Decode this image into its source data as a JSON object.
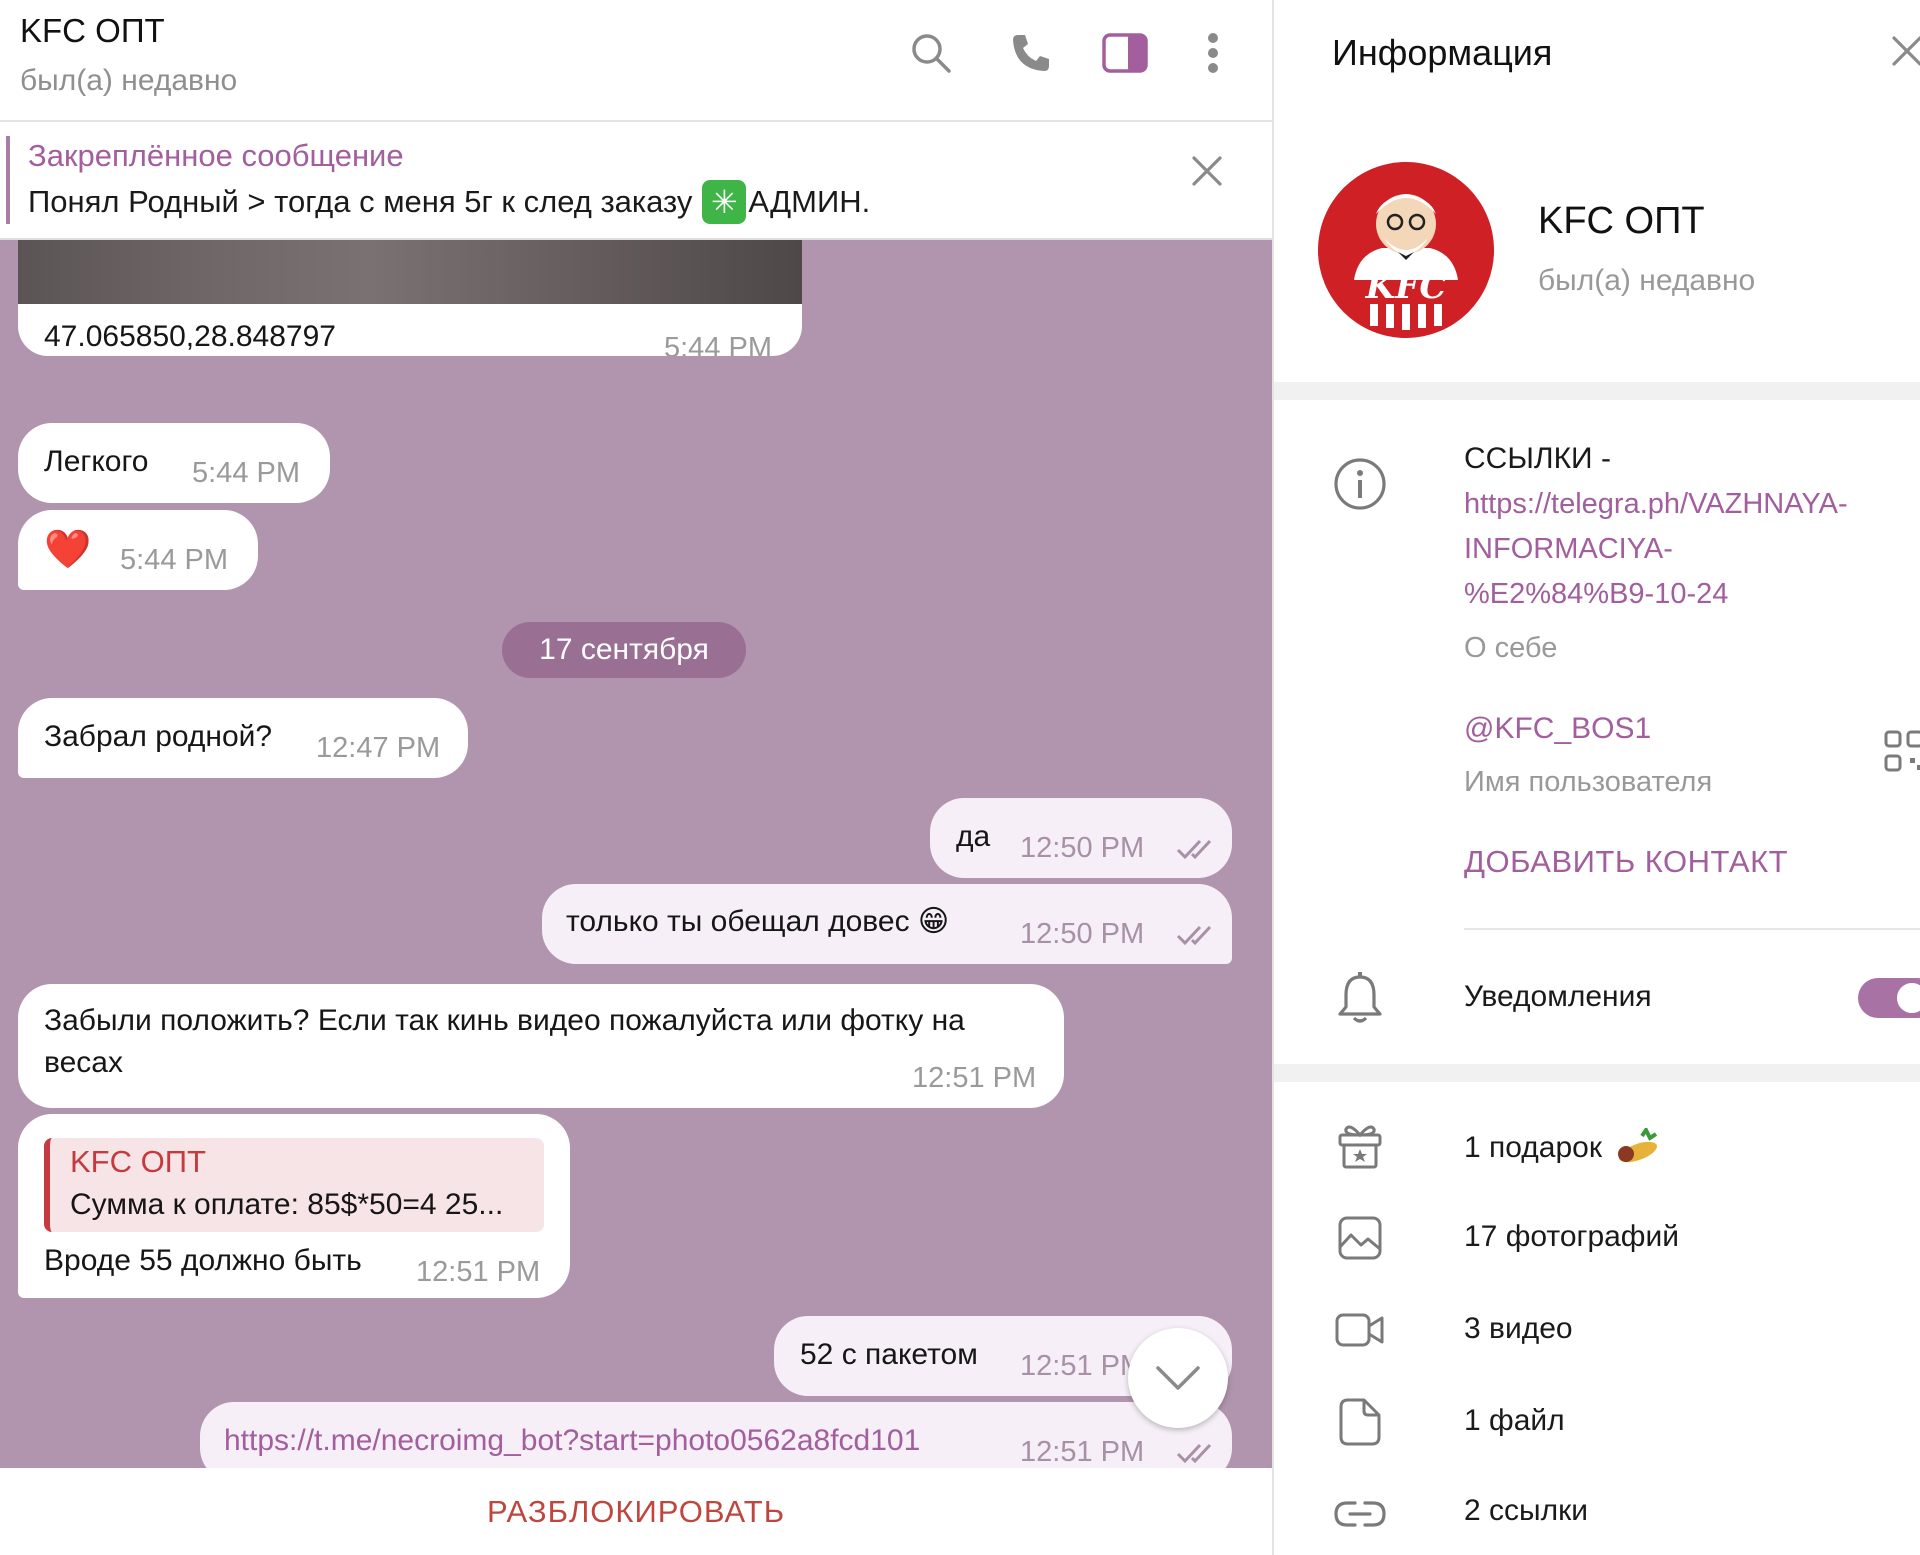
{
  "chat": {
    "title": "KFC ОПТ",
    "status": "был(а) недавно",
    "icons": [
      "search-icon",
      "phone-icon",
      "sidebar-toggle-icon",
      "more-vertical-icon"
    ]
  },
  "pinned": {
    "label": "Закреплённое сообщение",
    "text_before": "Понял Родный > тогда с меня 5г к след заказу",
    "emoji": "✳",
    "text_after": "АДМИН."
  },
  "messages": {
    "location": {
      "coords": "47.065850,28.848797",
      "time": "5:44 PM"
    },
    "m1": {
      "text": "Легкого",
      "time": "5:44 PM"
    },
    "m2": {
      "text": "❤️",
      "time": "5:44 PM"
    },
    "date": "17 сентября",
    "m3": {
      "text": "Забрал родной?",
      "time": "12:47 PM"
    },
    "m4": {
      "text": "да",
      "time": "12:50 PM"
    },
    "m5": {
      "text": "только ты обещал довес 😁",
      "time": "12:50 PM"
    },
    "m6": {
      "line1": "Забыли положить? Если так кинь видео пожалуйста или фотку на",
      "line2": "весах",
      "time": "12:51 PM"
    },
    "m7": {
      "reply_name": "KFC ОПТ",
      "reply_text": "Сумма к оплате: 85$*50=4 25...",
      "text": "Вроде 55 должно быть",
      "time": "12:51 PM"
    },
    "m8": {
      "text": "52 с пакетом",
      "time": "12:51 PM"
    },
    "m9": {
      "text": "https://t.me/necroimg_bot?start=photo0562a8fcd101",
      "time": "12:51 PM"
    }
  },
  "bottom": {
    "unblock": "РАЗБЛОКИРОВАТЬ"
  },
  "info": {
    "title": "Информация",
    "name": "KFC ОПТ",
    "status": "был(а) недавно",
    "avatar_text": "KFC",
    "bio_label": "ССЫЛКИ -",
    "bio_link_1": "https://telegra.ph/VAZHNAYA-",
    "bio_link_2": "INFORMACIYA-",
    "bio_link_3": "%E2%84%B9-10-24",
    "bio_caption": "О себе",
    "username": "@KFC_BOS1",
    "username_caption": "Имя пользователя",
    "add_contact": "ДОБАВИТЬ КОНТАКТ",
    "notifications": "Уведомления",
    "notifications_on": true,
    "media": [
      {
        "label": "1 подарок",
        "icon": "gift-icon"
      },
      {
        "label": "17 фотографий",
        "icon": "photo-icon"
      },
      {
        "label": "3 видео",
        "icon": "video-icon"
      },
      {
        "label": "1 файл",
        "icon": "file-icon"
      },
      {
        "label": "2 ссылки",
        "icon": "link-icon"
      }
    ]
  },
  "colors": {
    "chat_background": "#b195ae",
    "accent": "#a25e9d",
    "unblock": "#c0453f",
    "outgoing_bubble": "#f6eff7"
  }
}
